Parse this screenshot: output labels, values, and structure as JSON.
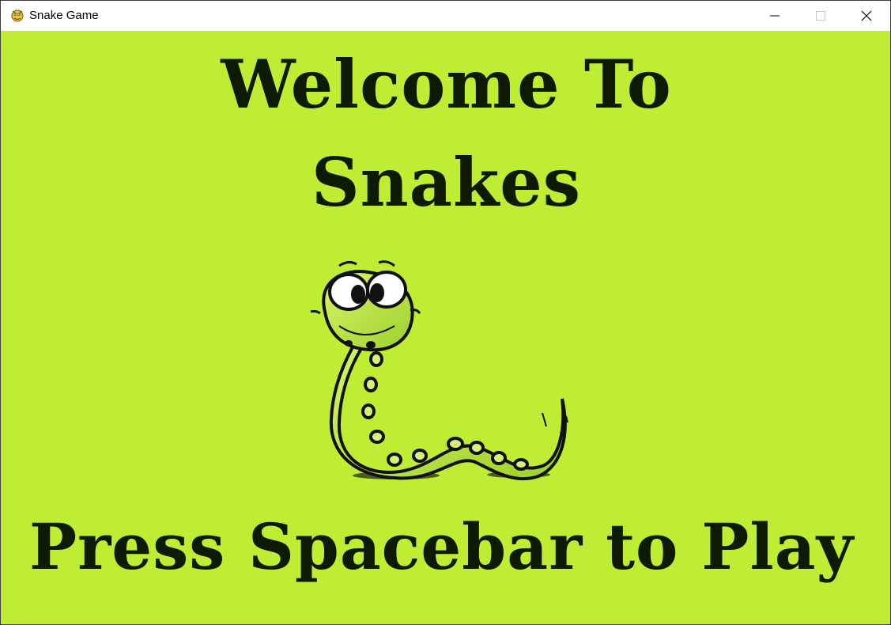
{
  "window": {
    "title": "Snake Game",
    "app_icon": "pygame-snake-icon"
  },
  "controls": {
    "minimize_icon": "minimize-icon",
    "maximize_icon": "maximize-icon",
    "close_icon": "close-icon"
  },
  "game": {
    "background_color": "#bfed34",
    "text_color": "#0f1a03",
    "welcome_line1": "Welcome To",
    "welcome_line2": "Snakes",
    "prompt": "Press Spacebar to Play",
    "illustration": "cartoon-snake"
  }
}
